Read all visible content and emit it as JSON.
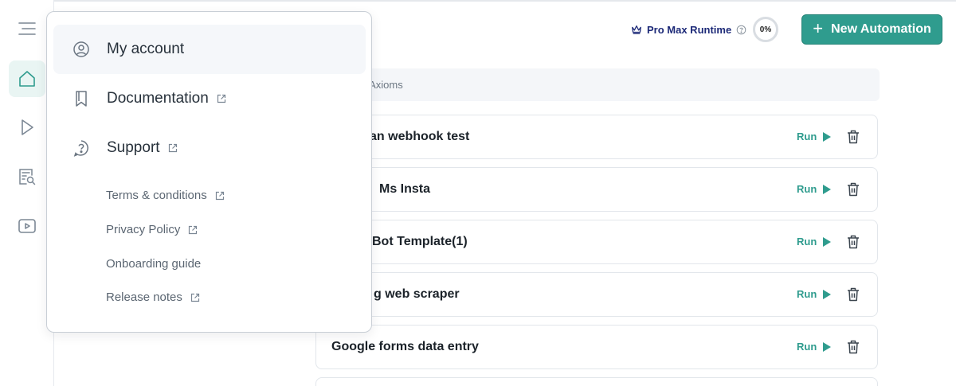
{
  "header": {
    "runtime_label": "Pro Max Runtime",
    "usage_percent": "0%",
    "new_button_label": "New Automation"
  },
  "search": {
    "placeholder_visible": "n Axioms"
  },
  "automations": [
    {
      "name": "an webhook test",
      "run_label": "Run"
    },
    {
      "name": "Ms Insta",
      "run_label": "Run"
    },
    {
      "name": "Bot Template(1)",
      "run_label": "Run"
    },
    {
      "name": "g web scraper",
      "run_label": "Run"
    },
    {
      "name": "Google forms data entry",
      "run_label": "Run"
    }
  ],
  "account_menu": {
    "items": [
      {
        "label": "My account",
        "icon": "user-circle-icon"
      },
      {
        "label": "Documentation",
        "icon": "bookmark-icon"
      },
      {
        "label": "Support",
        "icon": "question-circle-icon"
      }
    ],
    "links": [
      {
        "label": "Terms & conditions"
      },
      {
        "label": "Privacy Policy"
      },
      {
        "label": "Onboarding guide"
      },
      {
        "label": "Release notes"
      }
    ]
  },
  "colors": {
    "accent": "#2f9c8e",
    "brand_navy": "#1d2a78",
    "active_rail_bg": "#e9f5f3"
  }
}
